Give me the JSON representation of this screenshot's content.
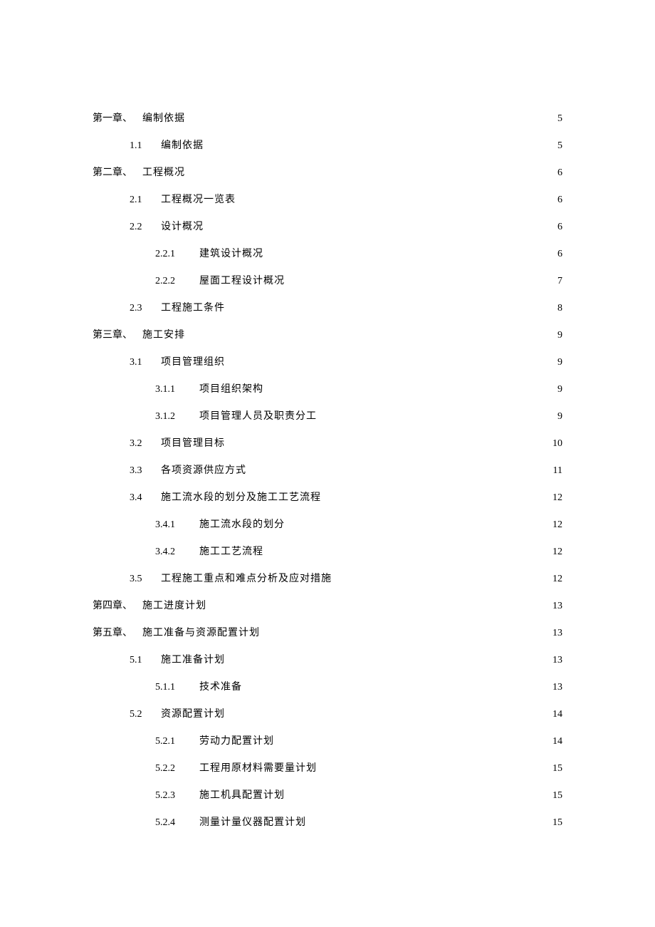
{
  "toc": [
    {
      "level": 0,
      "num": "第一章、",
      "title": "编制依据",
      "page": "5"
    },
    {
      "level": 1,
      "num": "1.1",
      "title": "编制依据",
      "page": "5"
    },
    {
      "level": 0,
      "num": "第二章、",
      "title": "工程概况",
      "page": "6"
    },
    {
      "level": 1,
      "num": "2.1",
      "title": "工程概况一览表",
      "page": "6"
    },
    {
      "level": 1,
      "num": "2.2",
      "title": "设计概况",
      "page": "6"
    },
    {
      "level": 2,
      "num": "2.2.1",
      "title": "建筑设计概况",
      "page": "6"
    },
    {
      "level": 2,
      "num": "2.2.2",
      "title": "屋面工程设计概况",
      "page": "7"
    },
    {
      "level": 1,
      "num": "2.3",
      "title": "工程施工条件",
      "page": "8"
    },
    {
      "level": 0,
      "num": "第三章、",
      "title": "施工安排",
      "page": "9"
    },
    {
      "level": 1,
      "num": "3.1",
      "title": "项目管理组织",
      "page": "9"
    },
    {
      "level": 2,
      "num": "3.1.1",
      "title": "项目组织架构",
      "page": "9"
    },
    {
      "level": 2,
      "num": "3.1.2",
      "title": "项目管理人员及职责分工",
      "page": "9"
    },
    {
      "level": 1,
      "num": "3.2",
      "title": "项目管理目标",
      "page": "10"
    },
    {
      "level": 1,
      "num": "3.3",
      "title": "各项资源供应方式",
      "page": "11"
    },
    {
      "level": 1,
      "num": "3.4",
      "title": "施工流水段的划分及施工工艺流程",
      "page": "12"
    },
    {
      "level": 2,
      "num": "3.4.1",
      "title": "施工流水段的划分",
      "page": "12"
    },
    {
      "level": 2,
      "num": "3.4.2",
      "title": "施工工艺流程",
      "page": "12"
    },
    {
      "level": 1,
      "num": "3.5",
      "title": "工程施工重点和难点分析及应对措施",
      "page": "12"
    },
    {
      "level": 0,
      "num": "第四章、",
      "title": "施工进度计划",
      "page": "13"
    },
    {
      "level": 0,
      "num": "第五章、",
      "title": "施工准备与资源配置计划",
      "page": "13"
    },
    {
      "level": 1,
      "num": "5.1",
      "title": "施工准备计划",
      "page": "13"
    },
    {
      "level": 2,
      "num": "5.1.1",
      "title": "技术准备",
      "page": "13"
    },
    {
      "level": 1,
      "num": "5.2",
      "title": "资源配置计划",
      "page": "14"
    },
    {
      "level": 2,
      "num": "5.2.1",
      "title": "劳动力配置计划",
      "page": "14"
    },
    {
      "level": 2,
      "num": "5.2.2",
      "title": "工程用原材料需要量计划",
      "page": "15"
    },
    {
      "level": 2,
      "num": "5.2.3",
      "title": "施工机具配置计划",
      "page": "15"
    },
    {
      "level": 2,
      "num": "5.2.4",
      "title": "测量计量仪器配置计划",
      "page": "15"
    }
  ]
}
